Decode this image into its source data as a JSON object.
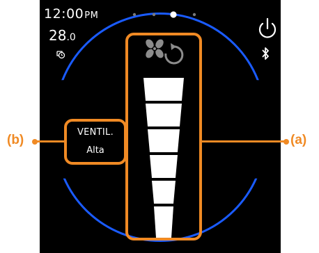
{
  "status": {
    "time": "12:00",
    "time_suffix": "PM",
    "temperature_int": "28",
    "temperature_dec": ".0",
    "schedule_icon": "schedule-clock-icon"
  },
  "pager": {
    "count": 4,
    "active_index": 2
  },
  "top_right": {
    "power_icon": "power-icon",
    "bluetooth_icon": "bluetooth-icon"
  },
  "fan": {
    "mode_label": "VENTIL.",
    "speed_label": "Alta",
    "icon": "fan-auto-icon",
    "level_count": 6,
    "level_active": 6
  },
  "callouts": {
    "a": "(a)",
    "b": "(b)"
  },
  "colors": {
    "accent": "#f08a24",
    "ring": "#1a5bff",
    "screen_bg": "#000000",
    "text": "#ffffff",
    "icon_gray": "#8c8c8c"
  }
}
